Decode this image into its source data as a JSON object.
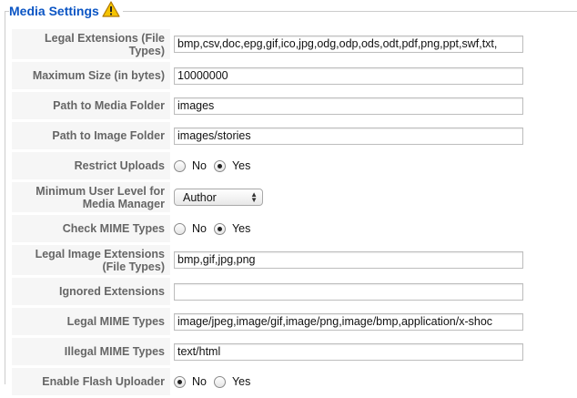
{
  "section": {
    "title": "Media Settings",
    "icon": "warning-icon",
    "warning_color": "#f5c400"
  },
  "fields": [
    {
      "label": "Legal Extensions (File Types)",
      "type": "text",
      "value": "bmp,csv,doc,epg,gif,ico,jpg,odg,odp,ods,odt,pdf,png,ppt,swf,txt,"
    },
    {
      "label": "Maximum Size (in bytes)",
      "type": "text",
      "value": "10000000"
    },
    {
      "label": "Path to Media Folder",
      "type": "text",
      "value": "images"
    },
    {
      "label": "Path to Image Folder",
      "type": "text",
      "value": "images/stories"
    },
    {
      "label": "Restrict Uploads",
      "type": "radio",
      "options": [
        "No",
        "Yes"
      ],
      "selected": "Yes"
    },
    {
      "label": "Minimum User Level for Media Manager",
      "type": "select",
      "value": "Author"
    },
    {
      "label": "Check MIME Types",
      "type": "radio",
      "options": [
        "No",
        "Yes"
      ],
      "selected": "Yes"
    },
    {
      "label": "Legal Image Extensions (File Types)",
      "type": "text",
      "value": "bmp,gif,jpg,png"
    },
    {
      "label": "Ignored Extensions",
      "type": "text",
      "value": ""
    },
    {
      "label": "Legal MIME Types",
      "type": "text",
      "value": "image/jpeg,image/gif,image/png,image/bmp,application/x-shoc"
    },
    {
      "label": "Illegal MIME Types",
      "type": "text",
      "value": "text/html"
    },
    {
      "label": "Enable Flash Uploader",
      "type": "radio",
      "options": [
        "No",
        "Yes"
      ],
      "selected": "No"
    }
  ]
}
